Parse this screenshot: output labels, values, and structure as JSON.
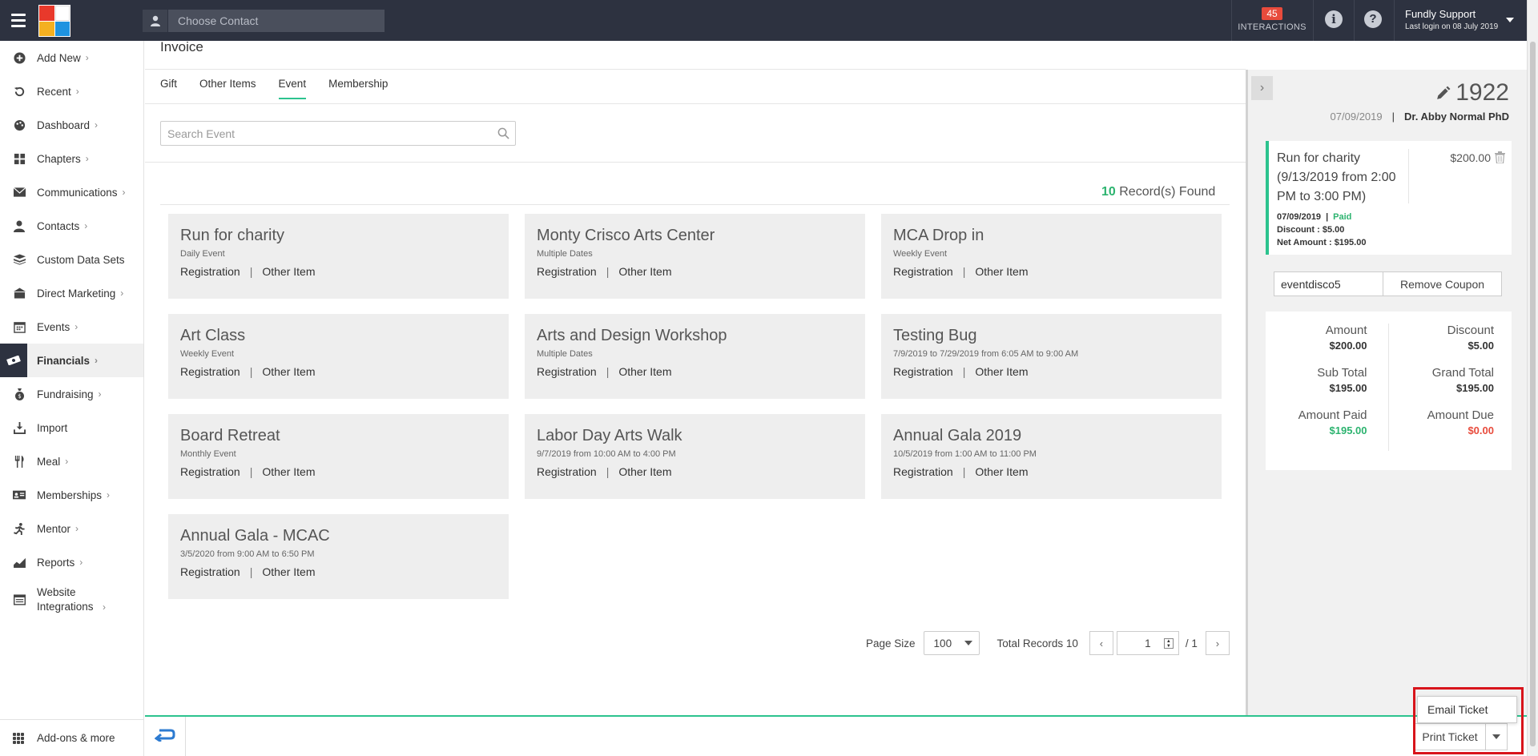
{
  "topbar": {
    "contact_placeholder": "Choose Contact",
    "interactions_count": "45",
    "interactions_label": "INTERACTIONS",
    "user_name": "Fundly Support",
    "last_login": "Last login on 08 July 2019"
  },
  "sidebar": {
    "items": [
      {
        "label": "Add New",
        "icon": "plus-circle-icon"
      },
      {
        "label": "Recent",
        "icon": "history-icon"
      },
      {
        "label": "Dashboard",
        "icon": "palette-icon"
      },
      {
        "label": "Chapters",
        "icon": "grid-icon"
      },
      {
        "label": "Communications",
        "icon": "envelope-icon"
      },
      {
        "label": "Contacts",
        "icon": "person-icon"
      },
      {
        "label": "Custom Data Sets",
        "icon": "layers-icon"
      },
      {
        "label": "Direct Marketing",
        "icon": "building-icon"
      },
      {
        "label": "Events",
        "icon": "calendar-icon"
      },
      {
        "label": "Financials",
        "icon": "money-icon"
      },
      {
        "label": "Fundraising",
        "icon": "moneybag-icon"
      },
      {
        "label": "Import",
        "icon": "download-icon"
      },
      {
        "label": "Meal",
        "icon": "utensils-icon"
      },
      {
        "label": "Memberships",
        "icon": "id-card-icon"
      },
      {
        "label": "Mentor",
        "icon": "running-icon"
      },
      {
        "label": "Reports",
        "icon": "chart-icon"
      },
      {
        "label": "Website Integrations",
        "icon": "window-icon"
      }
    ],
    "addons_label": "Add-ons & more"
  },
  "main": {
    "title": "Invoice",
    "tabs": [
      "Gift",
      "Other Items",
      "Event",
      "Membership"
    ],
    "active_tab": "Event",
    "search_placeholder": "Search Event",
    "records_count": "10",
    "records_label": "Record(s) Found",
    "link_registration": "Registration",
    "link_separator": "|",
    "link_other": "Other Item",
    "events": [
      {
        "name": "Run for charity",
        "date": "Daily Event"
      },
      {
        "name": "Monty Crisco Arts Center",
        "date": "Multiple Dates"
      },
      {
        "name": "MCA Drop in",
        "date": "Weekly Event"
      },
      {
        "name": "Art Class",
        "date": "Weekly Event"
      },
      {
        "name": "Arts and Design Workshop",
        "date": "Multiple Dates"
      },
      {
        "name": "Testing Bug",
        "date": "7/9/2019 to 7/29/2019 from 6:05 AM to 9:00 AM"
      },
      {
        "name": "Board Retreat",
        "date": "Monthly Event"
      },
      {
        "name": "Labor Day Arts Walk",
        "date": "9/7/2019 from 10:00 AM to 4:00 PM"
      },
      {
        "name": "Annual Gala 2019",
        "date": "10/5/2019 from 1:00 AM to 11:00 PM"
      },
      {
        "name": "Annual Gala - MCAC",
        "date": "3/5/2020 from 9:00 AM to 6:50 PM"
      }
    ],
    "pager": {
      "page_size_label": "Page Size",
      "page_size": "100",
      "total_records": "Total Records 10",
      "current_page": "1",
      "total_pages": "/ 1"
    }
  },
  "invoice_panel": {
    "number": "1922",
    "date": "07/09/2019",
    "separator": "|",
    "contact": "Dr. Abby Normal PhD",
    "line_item": {
      "name": "Run for charity (9/13/2019 from 2:00 PM to 3:00 PM)",
      "price": "$200.00",
      "date": "07/09/2019",
      "status": "Paid",
      "discount": "Discount : $5.00",
      "net_amount": "Net Amount : $195.00"
    },
    "coupon_code": "eventdisco5",
    "remove_coupon_label": "Remove Coupon",
    "totals": {
      "amount_label": "Amount",
      "amount": "$200.00",
      "discount_label": "Discount",
      "discount": "$5.00",
      "subtotal_label": "Sub Total",
      "subtotal": "$195.00",
      "grandtotal_label": "Grand Total",
      "grandtotal": "$195.00",
      "paid_label": "Amount Paid",
      "paid": "$195.00",
      "due_label": "Amount Due",
      "due": "$0.00"
    }
  },
  "bottombar": {
    "email_ticket_label": "Email Ticket",
    "print_ticket_label": "Print Ticket"
  },
  "colors": {
    "accent": "#2cc38e",
    "topbar": "#2d3240",
    "paid_green": "#2cb36f",
    "due_red": "#e84b3c",
    "highlight": "#d8141b"
  }
}
